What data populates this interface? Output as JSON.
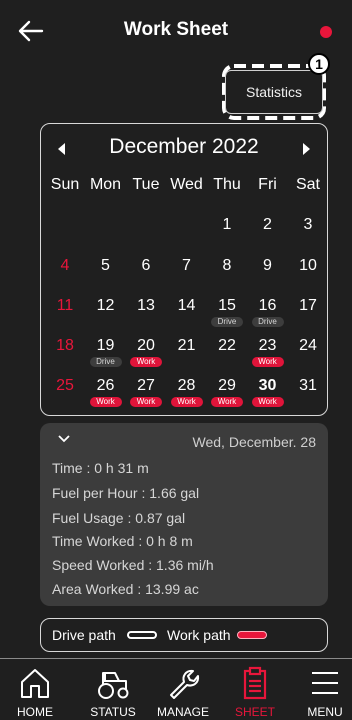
{
  "header": {
    "title": "Work Sheet",
    "back_icon": "arrow-left-icon",
    "status_color": "#e8163b"
  },
  "statistics": {
    "label": "Statistics",
    "badge": "1"
  },
  "calendar": {
    "month": "December 2022",
    "weekdays": [
      "Sun",
      "Mon",
      "Tue",
      "Wed",
      "Thu",
      "Fri",
      "Sat"
    ],
    "days": [
      {
        "d": "1"
      },
      {
        "d": "2"
      },
      {
        "d": "3"
      },
      {
        "d": "4"
      },
      {
        "d": "5"
      },
      {
        "d": "6"
      },
      {
        "d": "7"
      },
      {
        "d": "8"
      },
      {
        "d": "9"
      },
      {
        "d": "10"
      },
      {
        "d": "11"
      },
      {
        "d": "12"
      },
      {
        "d": "13"
      },
      {
        "d": "14"
      },
      {
        "d": "15",
        "tag": "Drive"
      },
      {
        "d": "16",
        "tag": "Drive"
      },
      {
        "d": "17"
      },
      {
        "d": "18"
      },
      {
        "d": "19",
        "tag": "Drive"
      },
      {
        "d": "20",
        "tag": "Work"
      },
      {
        "d": "21"
      },
      {
        "d": "22"
      },
      {
        "d": "23",
        "tag": "Work"
      },
      {
        "d": "24"
      },
      {
        "d": "25"
      },
      {
        "d": "26",
        "tag": "Work"
      },
      {
        "d": "27",
        "tag": "Work"
      },
      {
        "d": "28",
        "tag": "Work"
      },
      {
        "d": "29",
        "tag": "Work"
      },
      {
        "d": "30",
        "tag": "Work"
      },
      {
        "d": "31"
      }
    ]
  },
  "details": {
    "date": "Wed, December. 28",
    "time": "Time : 0 h 31 m",
    "fuel_per_hour": "Fuel per Hour : 1.66 gal",
    "fuel_usage": "Fuel Usage :  0.87 gal",
    "time_worked": "Time Worked : 0 h 8 m",
    "speed_worked": "Speed Worked :  1.36 mi/h",
    "area_worked": "Area Worked :  13.99 ac"
  },
  "legend": {
    "drive": "Drive path",
    "work": "Work path"
  },
  "nav": {
    "home": "HOME",
    "status": "STATUS",
    "manage": "MANAGE",
    "sheet": "SHEET",
    "menu": "MENU",
    "active": "SHEET",
    "accent": "#e8163b"
  }
}
